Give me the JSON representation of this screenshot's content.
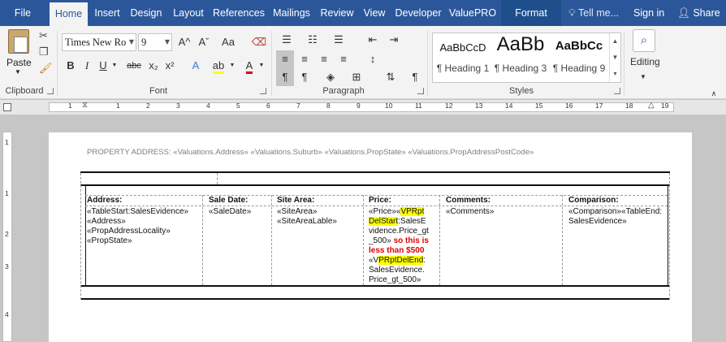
{
  "tabs": [
    {
      "label": "File"
    },
    {
      "label": "Home"
    },
    {
      "label": "Insert"
    },
    {
      "label": "Design"
    },
    {
      "label": "Layout"
    },
    {
      "label": "References"
    },
    {
      "label": "Mailings"
    },
    {
      "label": "Review"
    },
    {
      "label": "View"
    },
    {
      "label": "Developer"
    },
    {
      "label": "ValuePRO"
    },
    {
      "label": "Format"
    }
  ],
  "tell_me": "Tell me...",
  "sign_in": "Sign in",
  "share": "Share",
  "ribbon": {
    "clipboard": {
      "paste_label": "Paste",
      "group_label": "Clipboard"
    },
    "font": {
      "font_name": "Times New Ro",
      "font_size": "9",
      "group_label": "Font",
      "bold": "B",
      "italic": "I",
      "underline": "U",
      "strikethrough": "abc",
      "subscript": "x₂",
      "superscript": "x²",
      "grow": "A^",
      "shrink": "Aˇ",
      "case": "Aa"
    },
    "paragraph": {
      "group_label": "Paragraph"
    },
    "styles": {
      "group_label": "Styles",
      "items": [
        {
          "sample": "AaBbCcD",
          "name": "¶ Heading 1"
        },
        {
          "sample": "AaBb",
          "name": "¶ Heading 3"
        },
        {
          "sample": "AaBbCc",
          "name": "¶ Heading 9"
        }
      ]
    },
    "editing": {
      "label": "Editing"
    }
  },
  "ruler": {
    "numbers": [
      "1",
      "1",
      "2",
      "3",
      "4",
      "5",
      "6",
      "7",
      "8",
      "9",
      "10",
      "11",
      "12",
      "13",
      "14",
      "15",
      "16",
      "17",
      "18",
      "19"
    ],
    "vertical_numbers": [
      "1",
      "1",
      "2",
      "3",
      "4"
    ]
  },
  "document": {
    "property_address_line": "PROPERTY ADDRESS: «Valuations.Address» «Valuations.Suburb» «Valuations.PropState» «Valuations.PropAddressPostCode»",
    "table": {
      "headers": [
        "Address:",
        "Sale Date:",
        "Site Area:",
        "Price:",
        "Comments:",
        "Comparison:"
      ],
      "address_lines": [
        "«TableStart:SalesEvidence»",
        "«Address»",
        "«PropAddressLocality»",
        "«PropState»"
      ],
      "sale_date": "«SaleDate»",
      "site_area_lines": [
        "«SiteArea»",
        "«SiteAreaLable»"
      ],
      "price": {
        "line1_a": "«Price»«",
        "line1_b": "VPRpt",
        "line2_a": "DelStart",
        "line2_b": ":SalesE",
        "line3": "vidence.Price_gt",
        "line4_a": "_500»",
        "line4_b": " so this is",
        "line5": "less than $500",
        "line6_a": "«V",
        "line6_b": "PRptDelEnd",
        "line6_c": ":",
        "line7": "SalesEvidence.",
        "line8": "Price_gt_500»"
      },
      "comments": "«Comments»",
      "comparison_lines": [
        "«Comparison»«TableEnd:",
        "SalesEvidence»"
      ]
    }
  },
  "colors": {
    "title_bar": "#2b579a",
    "highlight": "#ffff00",
    "red_text": "#e00000"
  }
}
